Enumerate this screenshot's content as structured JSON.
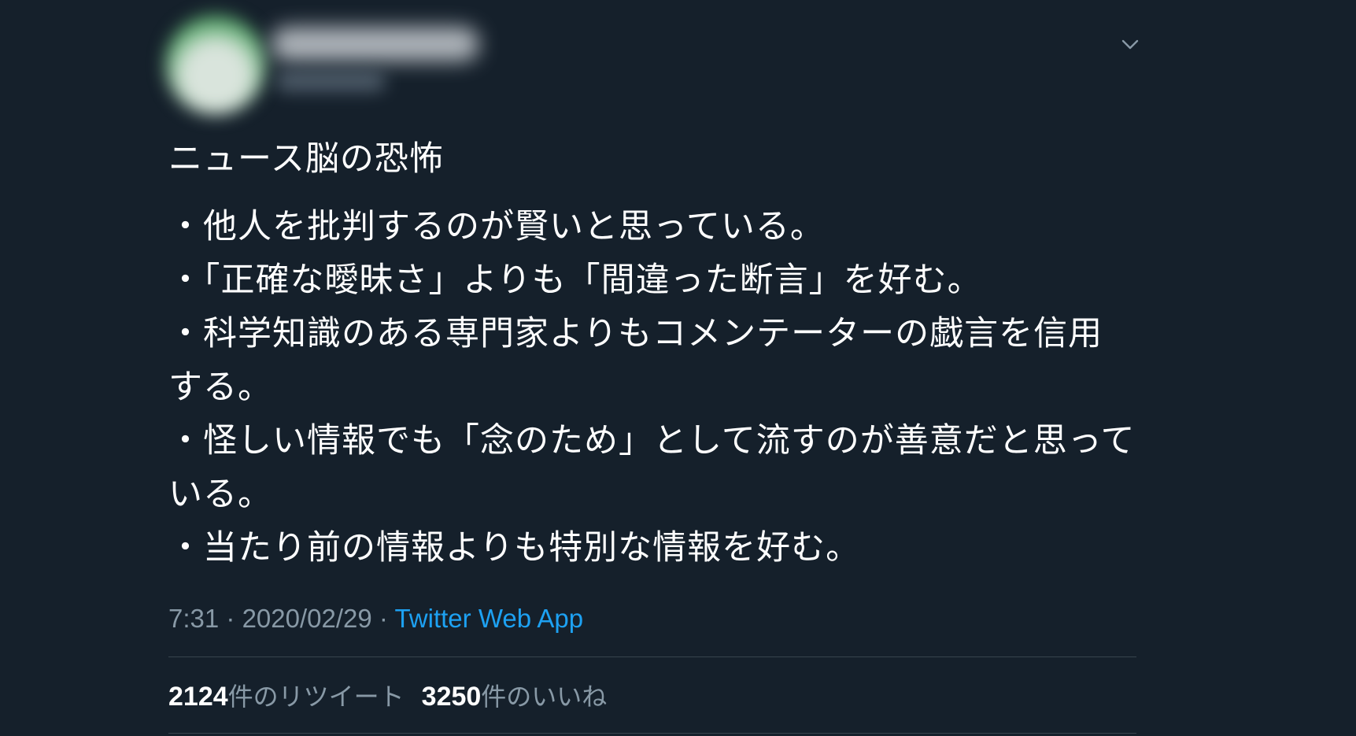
{
  "author": {
    "display_name": "●●●● ●●●●●",
    "handle": "@●●●●●●"
  },
  "tweet": {
    "title": "ニュース脳の恐怖",
    "lines": [
      "・他人を批判するのが賢いと思っている。",
      "・「正確な曖昧さ」よりも「間違った断言」を好む。",
      "・科学知識のある専門家よりもコメンテーターの戯言を信用する。",
      "・怪しい情報でも「念のため」として流すのが善意だと思っている。",
      "・当たり前の情報よりも特別な情報を好む。"
    ],
    "time": "7:31",
    "date": "2020/02/29",
    "separator": " · ",
    "source": "Twitter Web App"
  },
  "stats": {
    "retweets_count": "2124",
    "retweets_label": "件のリツイート",
    "likes_count": "3250",
    "likes_label": "件のいいね"
  },
  "icons": {
    "menu": "chevron-down-icon"
  },
  "colors": {
    "background": "#15202b",
    "text": "#ffffff",
    "muted": "#8899a6",
    "link": "#1da1f2",
    "divider": "#38444d"
  }
}
